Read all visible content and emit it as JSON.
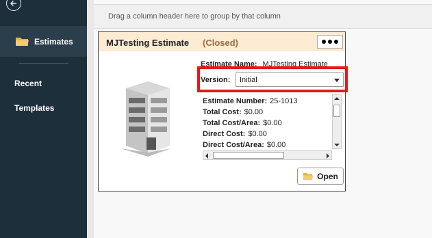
{
  "sidebar": {
    "back_icon": "back-arrow-icon",
    "active_item": {
      "icon": "folder-icon",
      "label": "Estimates"
    },
    "items": [
      {
        "label": "Recent"
      },
      {
        "label": "Templates"
      }
    ]
  },
  "group_bar": {
    "text": "Drag a column header here to group by that column"
  },
  "card": {
    "title": "MJTesting Estimate",
    "status": "(Closed)",
    "more_icon": "more-dots-icon",
    "image": "building-icon",
    "estimate_name_label": "Estimate Name:",
    "estimate_name_value": "MJTesting Estimate",
    "version_label": "Version:",
    "version_value": "Initial",
    "details": [
      {
        "label": "Estimate Number:",
        "value": "25-1013"
      },
      {
        "label": "Total Cost:",
        "value": "$0.00"
      },
      {
        "label": "Total Cost/Area:",
        "value": "$0.00"
      },
      {
        "label": "Direct Cost:",
        "value": "$0.00"
      },
      {
        "label": "Direct Cost/Area:",
        "value": "$0.00"
      }
    ],
    "open_label": "Open",
    "highlight_color": "#e21b1b",
    "header_color": "#fdebd3"
  }
}
